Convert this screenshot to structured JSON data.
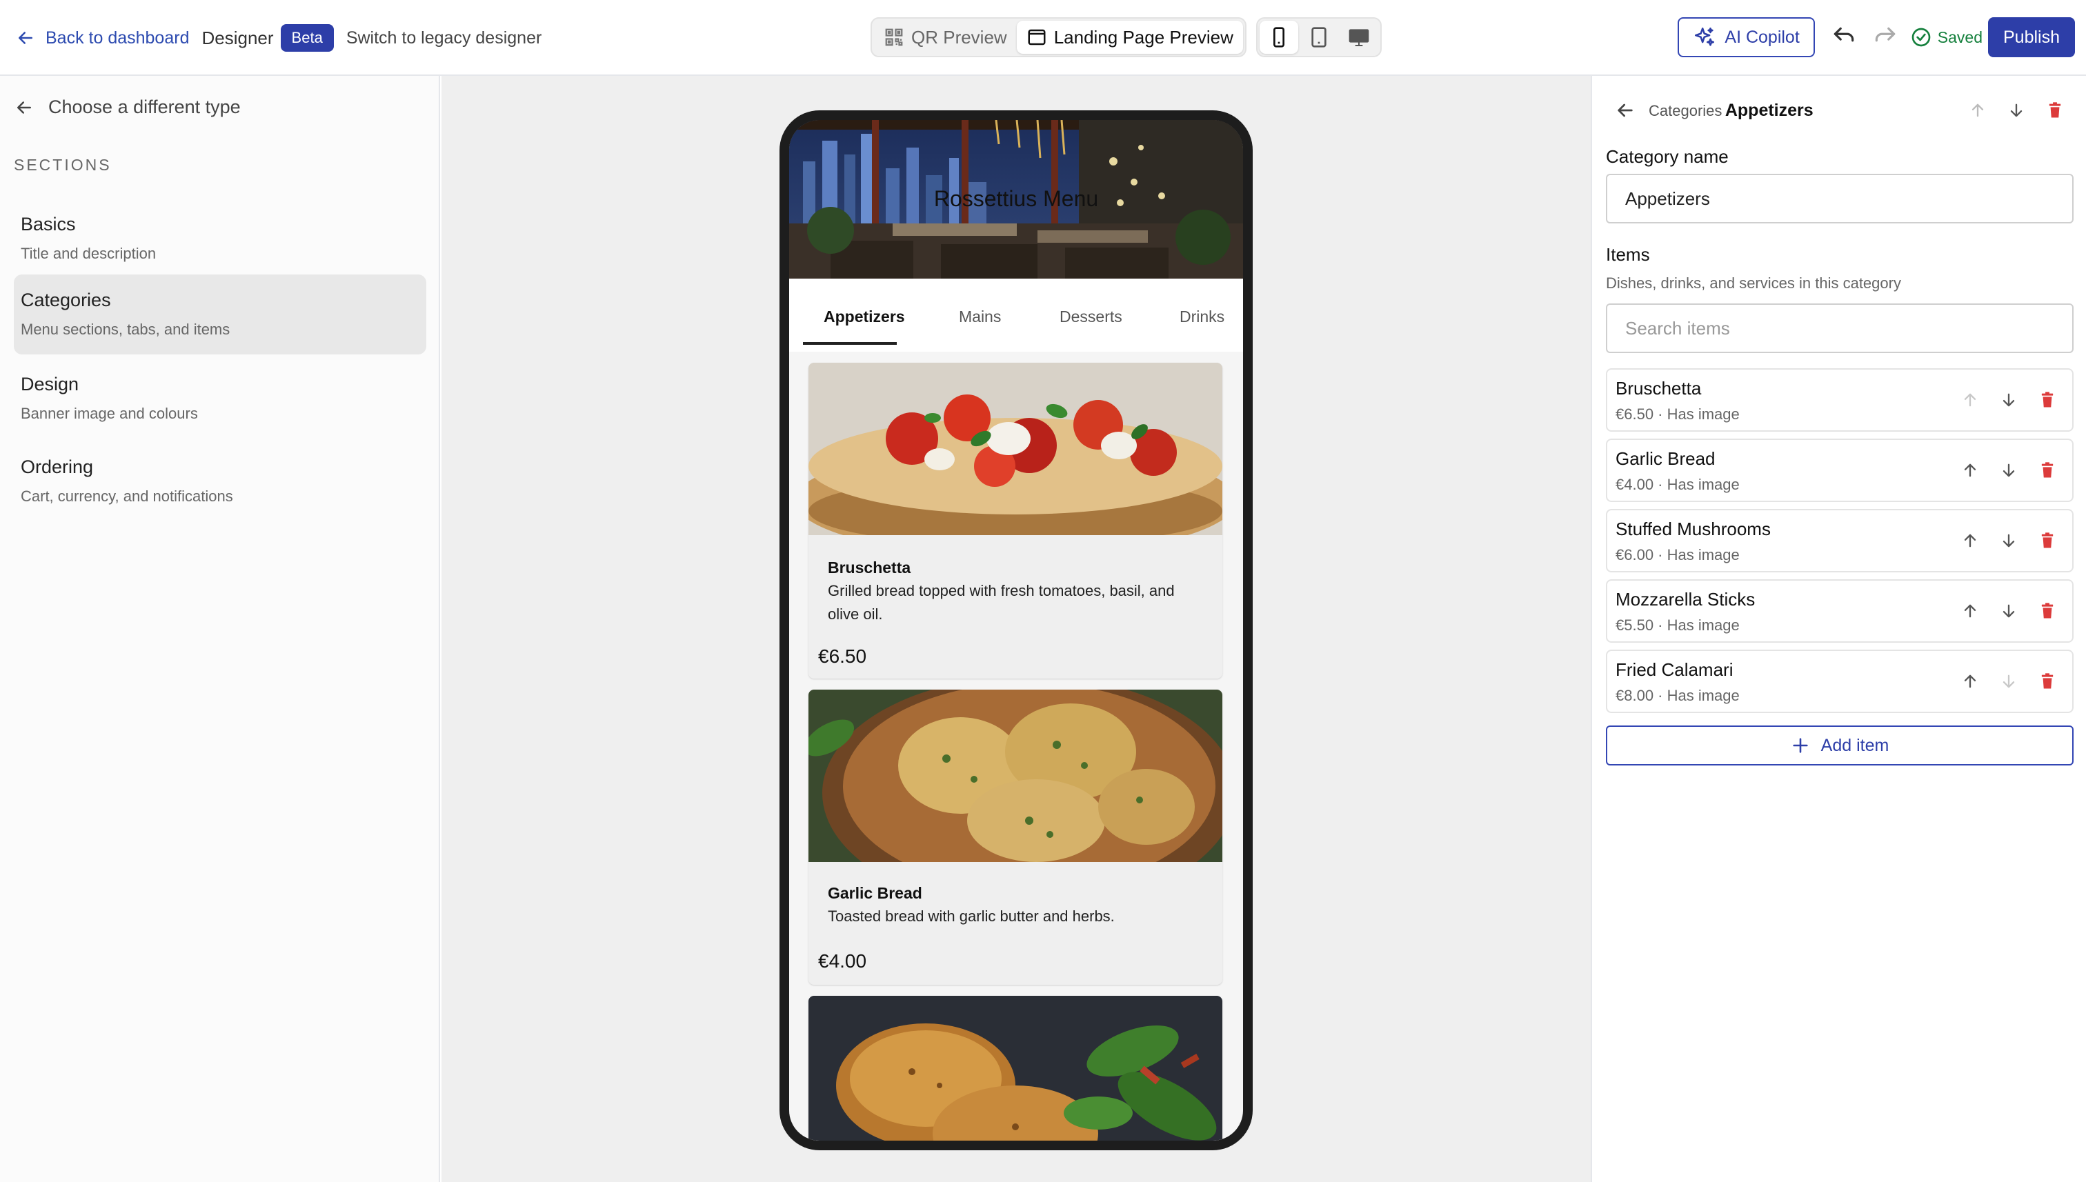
{
  "topbar": {
    "back_label": "Back to dashboard",
    "designer_label": "Designer",
    "beta_badge": "Beta",
    "legacy_link": "Switch to legacy designer",
    "qr_preview": "QR Preview",
    "landing_preview": "Landing Page Preview",
    "copilot_label": "AI Copilot",
    "saved_label": "Saved",
    "publish_label": "Publish"
  },
  "sidebar": {
    "choose_type": "Choose a different type",
    "sections_heading": "SECTIONS",
    "items": [
      {
        "title": "Basics",
        "subtitle": "Title and description"
      },
      {
        "title": "Categories",
        "subtitle": "Menu sections, tabs, and items"
      },
      {
        "title": "Design",
        "subtitle": "Banner image and colours"
      },
      {
        "title": "Ordering",
        "subtitle": "Cart, currency, and notifications"
      }
    ]
  },
  "preview": {
    "banner_title": "Rossettius Menu",
    "tabs": [
      "Appetizers",
      "Mains",
      "Desserts",
      "Drinks"
    ],
    "items": [
      {
        "name": "Bruschetta",
        "description": "Grilled bread topped with fresh tomatoes, basil, and olive oil.",
        "price": "€6.50"
      },
      {
        "name": "Garlic Bread",
        "description": "Toasted bread with garlic butter and herbs.",
        "price": "€4.00"
      }
    ]
  },
  "panel": {
    "breadcrumb": "Categories",
    "current": "Appetizers",
    "category_name_label": "Category name",
    "category_name_value": "Appetizers",
    "items_label": "Items",
    "items_sub": "Dishes, drinks, and services in this category",
    "search_placeholder": "Search items",
    "items": [
      {
        "name": "Bruschetta",
        "meta": "€6.50 · Has image"
      },
      {
        "name": "Garlic Bread",
        "meta": "€4.00 · Has image"
      },
      {
        "name": "Stuffed Mushrooms",
        "meta": "€6.00 · Has image"
      },
      {
        "name": "Mozzarella Sticks",
        "meta": "€5.50 · Has image"
      },
      {
        "name": "Fried Calamari",
        "meta": "€8.00 · Has image"
      }
    ],
    "add_item_label": "Add item"
  },
  "colors": {
    "accent": "#2d3ea8",
    "saved": "#15803d",
    "delete": "#dc3b3b"
  }
}
